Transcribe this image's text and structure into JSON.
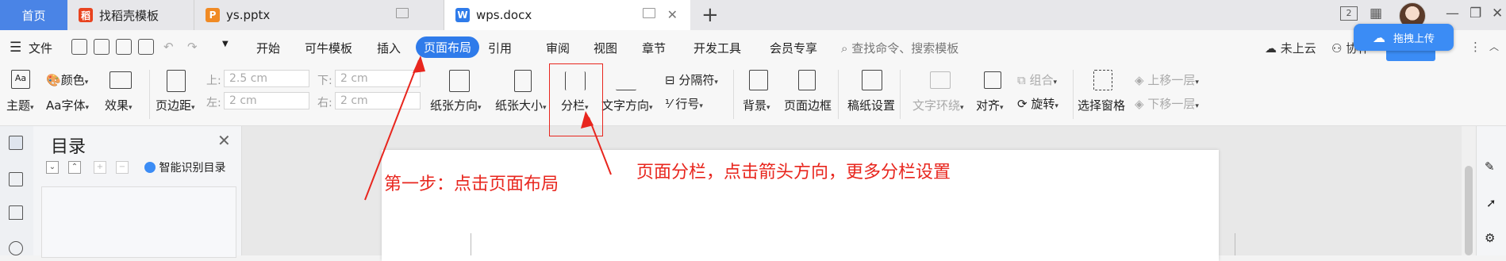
{
  "tabs": {
    "home": "首页",
    "template": "找稻壳模板",
    "pptx": "ys.pptx",
    "doc": "wps.docx",
    "doc_icon": "W",
    "pptx_icon": "P",
    "template_icon": "稻",
    "win_badge": "2"
  },
  "menu": {
    "file": "文件",
    "items": [
      "开始",
      "可牛模板",
      "插入",
      "页面布局",
      "引用",
      "审阅",
      "视图",
      "章节",
      "开发工具",
      "会员专享"
    ],
    "search": "查找命令、搜索模板",
    "cloud": "未上云",
    "collab": "协作",
    "upload": "拖拽上传"
  },
  "ribbon": {
    "theme": "主题",
    "color": "颜色",
    "font": "字体",
    "effect": "效果",
    "margin": "页边距",
    "top_lbl": "上:",
    "bottom_lbl": "下:",
    "left_lbl": "左:",
    "right_lbl": "右:",
    "top_val": "2.5 cm",
    "bottom_val": "2 cm",
    "left_val": "2 cm",
    "right_val": "2 cm",
    "orientation": "纸张方向",
    "size": "纸张大小",
    "columns": "分栏",
    "text_dir": "文字方向",
    "separator": "分隔符",
    "line_no": "行号",
    "background": "背景",
    "page_border": "页面边框",
    "manuscript": "稿纸设置",
    "wrap": "文字环绕",
    "align": "对齐",
    "rotate": "旋转",
    "group": "组合",
    "select_pane": "选择窗格",
    "bring_fwd": "上移一层",
    "send_back": "下移一层"
  },
  "toc": {
    "title": "目录",
    "smart": "智能识别目录"
  },
  "annotations": {
    "step1": "第一步：点击页面布局",
    "columns_note": "页面分栏，点击箭头方向，更多分栏设置"
  },
  "colors": {
    "accent": "#2f7bea",
    "annotation": "#e8261e"
  }
}
